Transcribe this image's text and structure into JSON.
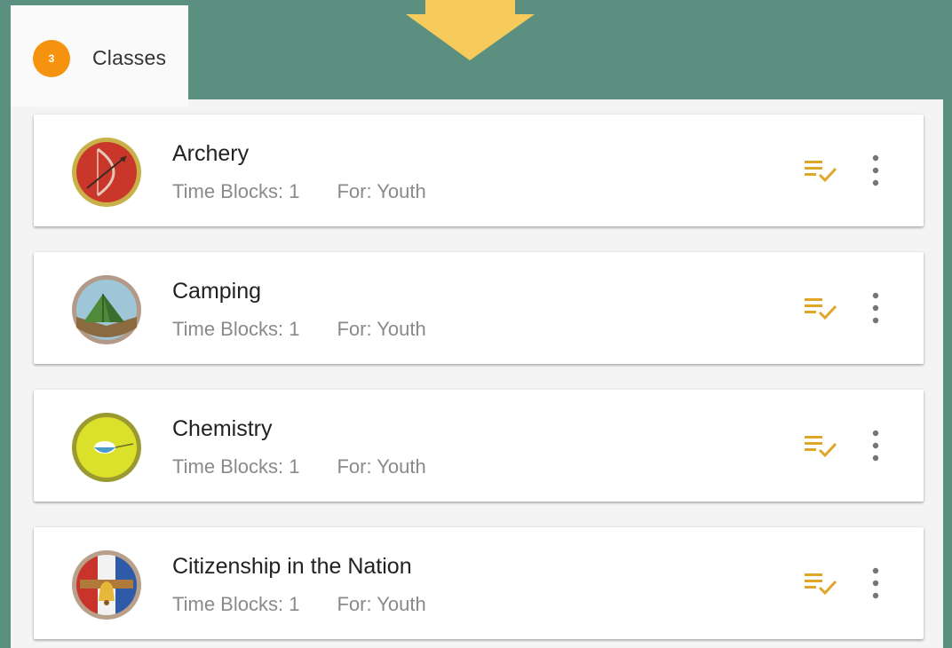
{
  "header": {
    "step_number": "3",
    "title": "Classes"
  },
  "classes": [
    {
      "name": "Archery",
      "time_blocks": "Time Blocks: 1",
      "audience": "For: Youth",
      "badge_icon": "archery-badge-icon"
    },
    {
      "name": "Camping",
      "time_blocks": "Time Blocks: 1",
      "audience": "For: Youth",
      "badge_icon": "camping-badge-icon"
    },
    {
      "name": "Chemistry",
      "time_blocks": "Time Blocks: 1",
      "audience": "For: Youth",
      "badge_icon": "chemistry-badge-icon"
    },
    {
      "name": "Citizenship in the Nation",
      "time_blocks": "Time Blocks: 1",
      "audience": "For: Youth",
      "badge_icon": "citizenship-nation-badge-icon"
    }
  ],
  "colors": {
    "background": "#5b8f80",
    "arrow": "#f7cb5b",
    "step_badge": "#f5930f",
    "action_icon": "#e0a62a"
  }
}
